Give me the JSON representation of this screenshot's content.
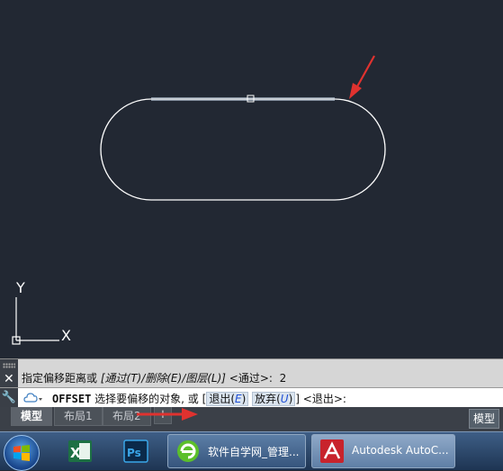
{
  "command_history": {
    "prompt": "指定偏移距离或 ",
    "options_bracket": "[通过(T)/删除(E)/图层(L)]",
    "default": " <通过>:  ",
    "value": "2"
  },
  "command_line": {
    "command": "OFFSET",
    "prompt": " 选择要偏移的对象, 或 [",
    "option1_pre": "退出(",
    "option1_key": "E",
    "option1_post": ")",
    "option2_pre": "放弃(",
    "option2_key": "U",
    "option2_post": ")",
    "suffix": "] <退出>:"
  },
  "tabs": [
    {
      "label": "模型",
      "active": true
    },
    {
      "label": "布局1",
      "active": false
    },
    {
      "label": "布局2",
      "active": false
    }
  ],
  "tab_add_label": "+",
  "status_model_label": "模型",
  "close_glyph": "✕",
  "ucs": {
    "y_label": "Y",
    "x_label": "X"
  },
  "taskbar": {
    "apps": [
      {
        "name": "excel-icon",
        "label": "X"
      },
      {
        "name": "photoshop-icon",
        "label": "Ps"
      }
    ],
    "tasks": [
      {
        "label": "软件自学网_管理..."
      },
      {
        "label": "Autodesk AutoC..."
      }
    ]
  },
  "colors": {
    "canvas_bg": "#222833",
    "arrow": "#e0322f",
    "shape_stroke": "#ffffff"
  }
}
